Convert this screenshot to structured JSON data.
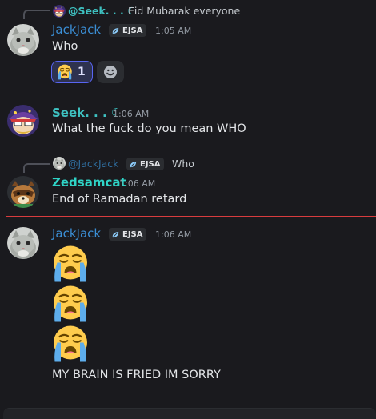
{
  "messages": {
    "m1": {
      "reply": {
        "author": "@Seek. . . ☾",
        "text": "Eid Mubarak everyone"
      },
      "author": "JackJack",
      "tag": "EJSA",
      "time": "1:05 AM",
      "text": "Who",
      "reaction": {
        "emoji": "loudly-crying-face",
        "count": "1"
      }
    },
    "m2": {
      "author": "Seek. . . ☾",
      "time": "1:06 AM",
      "text": "What the fuck do you mean WHO"
    },
    "m3": {
      "reply": {
        "author": "@JackJack",
        "tag": "EJSA",
        "text": "Who"
      },
      "author": "Zedsamcat",
      "time": "1:06 AM",
      "text": "End of Ramadan retard"
    },
    "m4": {
      "author": "JackJack",
      "tag": "EJSA",
      "time": "1:06 AM",
      "emojis": [
        "loudly-crying-face",
        "loudly-crying-face",
        "loudly-crying-face"
      ],
      "text": "MY BRAIN IS FRIED IM SORRY"
    }
  },
  "colors": {
    "background": "#1a1a1e",
    "jack_name": "#3b8fd6",
    "seek_name": "#3ec1c1",
    "zed_name": "#2fd4c7",
    "new_messages_divider": "#d83c3e",
    "reaction_active_border": "#5865f2"
  }
}
